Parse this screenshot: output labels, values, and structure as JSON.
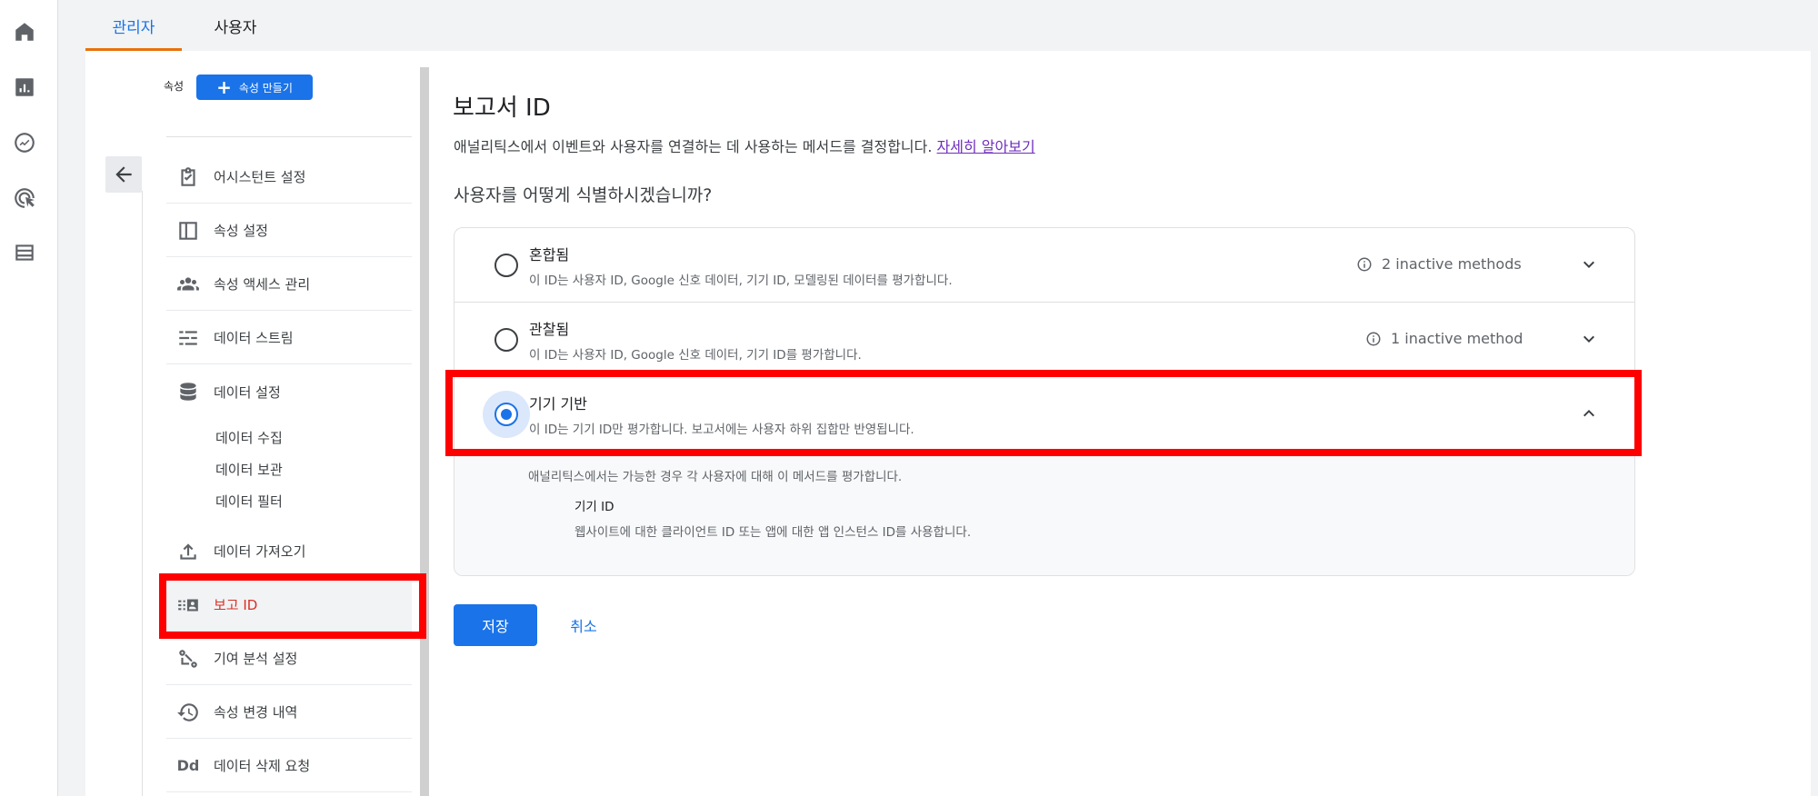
{
  "colors": {
    "accent": "#1a73e8",
    "highlight": "#ff0000",
    "active_text": "#d93025",
    "tab_underline": "#e8710a",
    "link": "#6f2dbd"
  },
  "rail": {
    "icons": [
      "home-icon",
      "reports-icon",
      "explore-icon",
      "advertising-icon",
      "configure-icon"
    ]
  },
  "tabs": [
    {
      "label": "관리자",
      "active": true
    },
    {
      "label": "사용자",
      "active": false
    }
  ],
  "property": {
    "label": "속성",
    "create_button": "속성 만들기"
  },
  "nav": {
    "items": [
      {
        "label": "어시스턴트 설정",
        "icon": "checklist-icon"
      },
      {
        "label": "속성 설정",
        "icon": "layout-icon"
      },
      {
        "label": "속성 액세스 관리",
        "icon": "people-icon"
      },
      {
        "label": "데이터 스트림",
        "icon": "stream-icon"
      },
      {
        "label": "데이터 설정",
        "icon": "database-icon"
      },
      {
        "label": "데이터 가져오기",
        "icon": "upload-icon"
      },
      {
        "label": "보고 ID",
        "icon": "report-id-icon",
        "active": true
      },
      {
        "label": "기여 분석 설정",
        "icon": "attribution-icon"
      },
      {
        "label": "속성 변경 내역",
        "icon": "history-icon"
      },
      {
        "label": "데이터 삭제 요청",
        "icon": "dd-icon"
      }
    ],
    "sub_items": [
      "데이터 수집",
      "데이터 보관",
      "데이터 필터"
    ]
  },
  "main": {
    "title": "보고서 ID",
    "description": "애널리틱스에서 이벤트와 사용자를 연결하는 데 사용하는 메서드를 결정합니다.",
    "learn_more": "자세히 알아보기",
    "question": "사용자를 어떻게 식별하시겠습니까?",
    "options": [
      {
        "title": "혼합됨",
        "desc": "이 ID는 사용자 ID, Google 신호 데이터, 기기 ID, 모델링된 데이터를 평가합니다.",
        "info": "2 inactive methods",
        "selected": false
      },
      {
        "title": "관찰됨",
        "desc": "이 ID는 사용자 ID, Google 신호 데이터, 기기 ID를 평가합니다.",
        "info": "1 inactive method",
        "selected": false
      },
      {
        "title": "기기 기반",
        "desc": "이 ID는 기기 ID만 평가합니다. 보고서에는 사용자 하위 집합만 반영됩니다.",
        "info": "",
        "selected": true
      }
    ],
    "expanded": {
      "note": "애널리틱스에서는 가능한 경우 각 사용자에 대해 이 메서드를 평가합니다.",
      "id_title": "기기 ID",
      "id_desc": "웹사이트에 대한 클라이언트 ID 또는 앱에 대한 앱 인스턴스 ID를 사용합니다."
    },
    "save_button": "저장",
    "cancel_button": "취소"
  }
}
